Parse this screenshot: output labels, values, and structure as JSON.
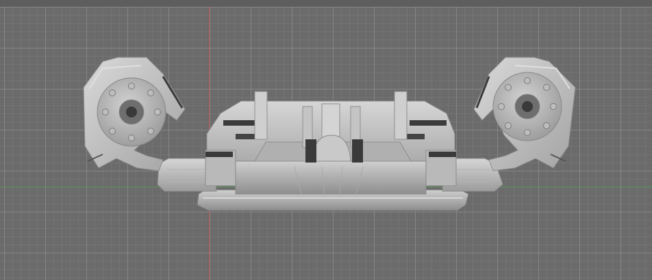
{
  "viewport": {
    "background": "#6b6b6b",
    "grid_color": "#969696",
    "x_axis_color": "#4f9a4f",
    "y_axis_color": "#c0504d",
    "model_color": "#c8c8c8"
  }
}
